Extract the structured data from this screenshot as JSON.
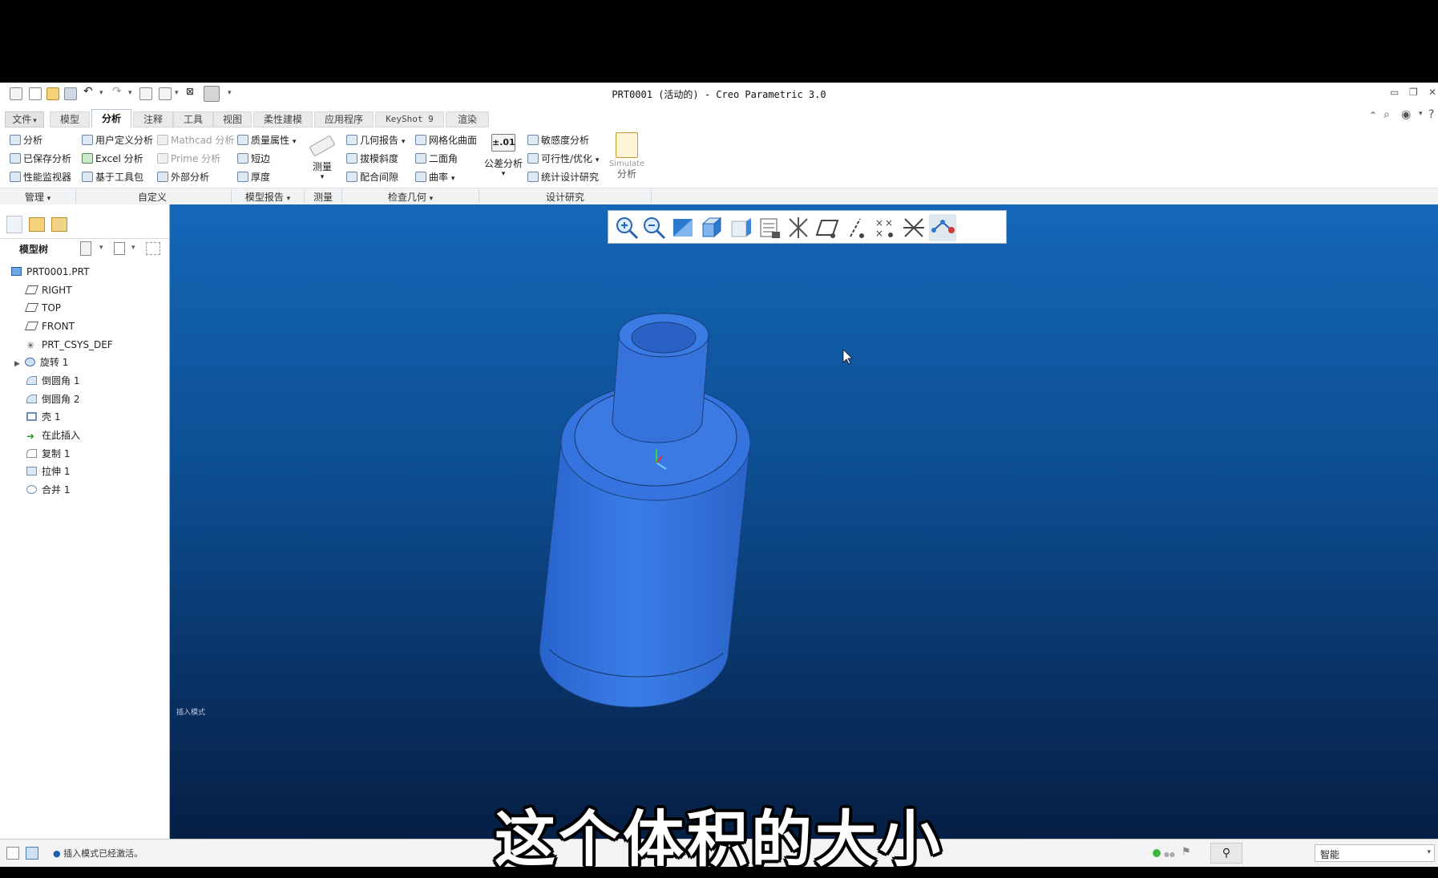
{
  "window": {
    "title": "PRT0001 (活动的) - Creo Parametric 3.0"
  },
  "tabs": [
    {
      "label": "文件",
      "caret": "▾"
    },
    {
      "label": "模型"
    },
    {
      "label": "分析"
    },
    {
      "label": "注释"
    },
    {
      "label": "工具"
    },
    {
      "label": "视图"
    },
    {
      "label": "柔性建模"
    },
    {
      "label": "应用程序"
    },
    {
      "label": "KeyShot 9"
    },
    {
      "label": "渲染"
    }
  ],
  "ribbon": {
    "manage": [
      "分析",
      "已保存分析",
      "性能监视器"
    ],
    "custom": [
      "用户定义分析",
      "Excel 分析",
      "基于工具包"
    ],
    "custom_disabled": [
      "Mathcad 分析",
      "Prime 分析"
    ],
    "custom_extra": "外部分析",
    "model_report": [
      "质量属性",
      "短边",
      "厚度"
    ],
    "measure": "测量",
    "inspect_geometry": [
      "几何报告",
      "拔模斜度",
      "配合间隙",
      "网格化曲面",
      "二面角",
      "曲率"
    ],
    "tolerance": {
      "label": "公差分析",
      "icon_text": "±.01"
    },
    "design_study": [
      "敏感度分析",
      "可行性/优化",
      "统计设计研究"
    ],
    "simulate": [
      "Simulate",
      "分析"
    ]
  },
  "groups": [
    "管理",
    "自定义",
    "模型报告",
    "测量",
    "检查几何",
    "设计研究"
  ],
  "model_tree": {
    "header": "模型树",
    "items": [
      {
        "label": "PRT0001.PRT",
        "icon": "part-icon"
      },
      {
        "label": "RIGHT",
        "icon": "datum-plane-icon"
      },
      {
        "label": "TOP",
        "icon": "datum-plane-icon"
      },
      {
        "label": "FRONT",
        "icon": "datum-plane-icon"
      },
      {
        "label": "PRT_CSYS_DEF",
        "icon": "csys-icon"
      },
      {
        "label": "旋转 1",
        "icon": "revolve-icon"
      },
      {
        "label": "倒圆角 1",
        "icon": "round-icon"
      },
      {
        "label": "倒圆角 2",
        "icon": "round-icon"
      },
      {
        "label": "壳 1",
        "icon": "shell-icon"
      },
      {
        "label": "在此插入",
        "icon": "insert-arrow-icon"
      },
      {
        "label": "复制 1",
        "icon": "copy-icon"
      },
      {
        "label": "拉伸 1",
        "icon": "extrude-icon"
      },
      {
        "label": "合并 1",
        "icon": "merge-icon"
      }
    ]
  },
  "viewport": {
    "mode_label": "插入模式"
  },
  "status": {
    "message": "插入模式已经激活。",
    "filter": "智能"
  },
  "subtitle": "这个体积的大小",
  "colors": {
    "part": "#2f70e0",
    "viewport_top": "#1467b8",
    "viewport_bottom": "#061f45",
    "active_tab_border": "#b7c3cf"
  }
}
